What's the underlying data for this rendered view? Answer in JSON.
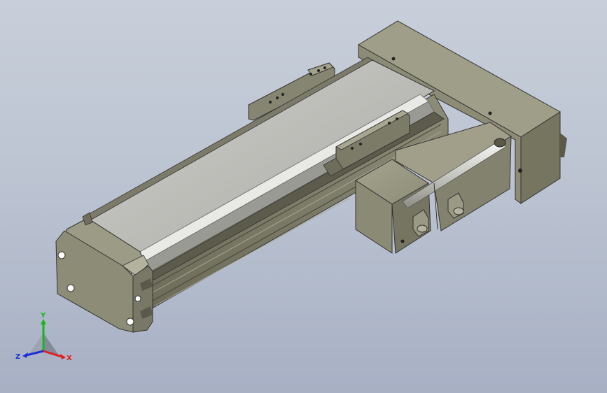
{
  "viewport": {
    "background_top": "#c8cfda",
    "background_bottom": "#a7b0c4"
  },
  "model": {
    "body_color": "#8c8b78",
    "body_dark": "#666553",
    "body_light": "#a9a893",
    "cover_color": "#bdbdb9",
    "motor_color": "#85846f"
  },
  "triad": {
    "labels": {
      "x": "X",
      "y": "Y",
      "z": "Z"
    },
    "colors": {
      "x": "#e0201c",
      "y": "#19b519",
      "z": "#1c2fd8"
    }
  }
}
